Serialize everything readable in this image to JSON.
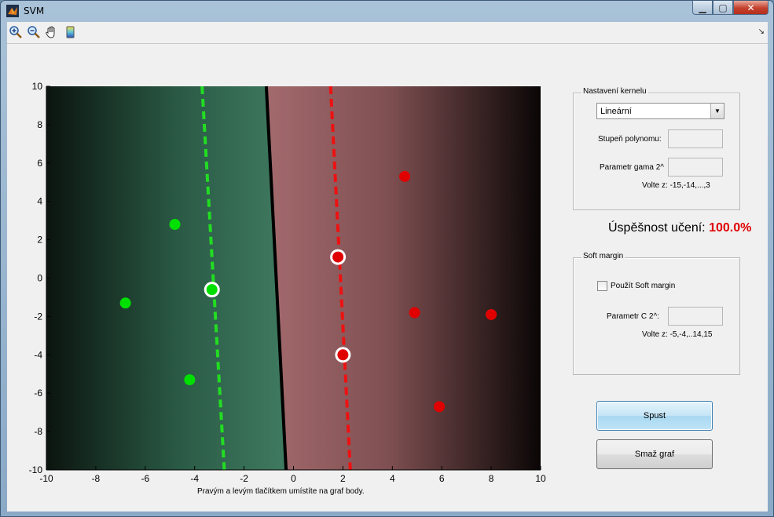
{
  "window": {
    "title": "SVM"
  },
  "toolbar": {
    "icons": [
      "zoom-in-icon",
      "zoom-out-icon",
      "pan-hand-icon",
      "colorbar-icon"
    ],
    "overflow": "↘"
  },
  "chart_data": {
    "type": "scatter",
    "title": "",
    "xlabel": "Pravým a levým tlačítkem umístíte na graf body.",
    "ylabel": "",
    "xlim": [
      -10,
      10
    ],
    "ylim": [
      -10,
      10
    ],
    "x_ticks": [
      -10,
      -8,
      -6,
      -4,
      -2,
      0,
      2,
      4,
      6,
      8,
      10
    ],
    "y_ticks": [
      -10,
      -8,
      -6,
      -4,
      -2,
      0,
      2,
      4,
      6,
      8,
      10
    ],
    "grid": false,
    "background": "decision-function shading (green class region left, red class region right)",
    "series": [
      {
        "color": "#00e000",
        "points": [
          [
            -6.8,
            -1.3
          ],
          [
            -4.8,
            2.8
          ],
          [
            -4.2,
            -5.3
          ],
          [
            -3.3,
            -0.6
          ]
        ],
        "support_vectors": [
          [
            -3.3,
            -0.6
          ]
        ]
      },
      {
        "color": "#e00000",
        "points": [
          [
            4.5,
            5.3
          ],
          [
            4.9,
            -1.8
          ],
          [
            8.0,
            -1.9
          ],
          [
            5.9,
            -6.7
          ],
          [
            1.8,
            1.1
          ],
          [
            2.0,
            -4.0
          ]
        ],
        "support_vectors": [
          [
            1.8,
            1.1
          ],
          [
            2.0,
            -4.0
          ]
        ]
      }
    ],
    "lines": [
      {
        "role": "decision-boundary",
        "color": "#000000",
        "style": "solid",
        "from": [
          -1.1,
          10
        ],
        "to": [
          -0.3,
          -10
        ]
      },
      {
        "role": "margin-green",
        "color": "#22dd22",
        "style": "dashed",
        "from": [
          -3.7,
          10
        ],
        "to": [
          -2.8,
          -10
        ]
      },
      {
        "role": "margin-red",
        "color": "#ee1111",
        "style": "dashed",
        "from": [
          1.5,
          10
        ],
        "to": [
          2.3,
          -10
        ]
      }
    ]
  },
  "kernel_panel": {
    "title": "Nastavení kernelu",
    "kernel_select": "Lineární",
    "degree_label": "Stupeň polynomu:",
    "degree_value": "",
    "gamma_label": "Parametr gama 2^",
    "gamma_value": "",
    "gamma_hint": "Volte z: -15,-14,...,3"
  },
  "accuracy": {
    "label": "Úspěšnost učení:",
    "value": "100.0%"
  },
  "soft_margin_panel": {
    "title": "Soft margin",
    "checkbox_label": "Použít Soft margin",
    "checked": false,
    "c_label": "Parametr C 2^:",
    "c_value": "",
    "c_hint": "Volte z: -5,-4,..14,15"
  },
  "buttons": {
    "run": "Spust",
    "clear": "Smaž graf"
  }
}
